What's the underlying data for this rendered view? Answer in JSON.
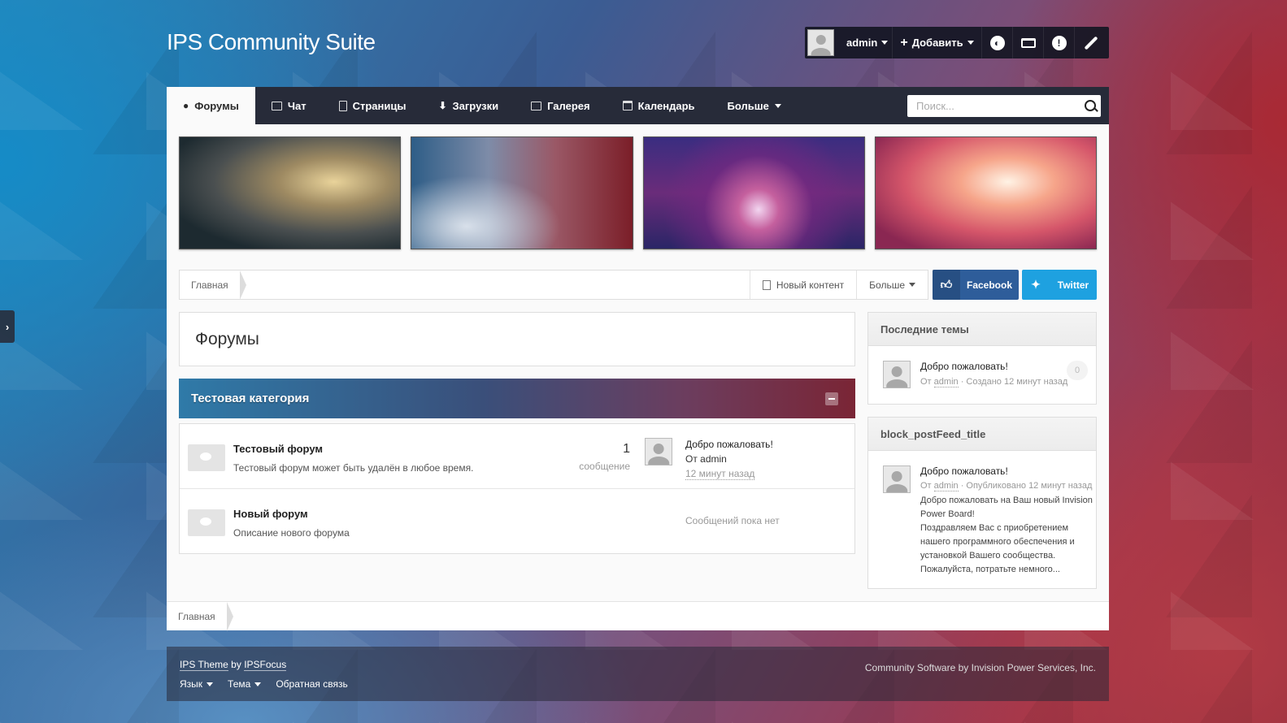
{
  "site": {
    "title": "IPS Community Suite"
  },
  "userbar": {
    "username": "admin",
    "create_label": "Добавить",
    "icons": [
      "globe-icon",
      "inbox-icon",
      "notifications-icon",
      "theme-brush-icon"
    ]
  },
  "nav": {
    "tabs": [
      {
        "label": "Форумы",
        "icon": "forums-icon",
        "active": true
      },
      {
        "label": "Чат",
        "icon": "chat-icon"
      },
      {
        "label": "Страницы",
        "icon": "pages-icon"
      },
      {
        "label": "Загрузки",
        "icon": "downloads-icon"
      },
      {
        "label": "Галерея",
        "icon": "gallery-icon"
      },
      {
        "label": "Календарь",
        "icon": "calendar-icon"
      },
      {
        "label": "Больше",
        "icon": "caret-down-icon"
      }
    ],
    "search_placeholder": "Поиск..."
  },
  "breadcrumb": {
    "home": "Главная",
    "new_content": "Новый контент",
    "more": "Больше"
  },
  "share": {
    "facebook": "Facebook",
    "twitter": "Twitter"
  },
  "page": {
    "title": "Форумы"
  },
  "category": {
    "title": "Тестовая категория",
    "forums": [
      {
        "title": "Тестовый форум",
        "description": "Тестовый форум может быть удалён в любое время.",
        "count": "1",
        "count_label": "сообщение",
        "last_title": "Добро пожаловать!",
        "last_by": "От admin",
        "last_time": "12 минут назад"
      },
      {
        "title": "Новый форум",
        "description": "Описание нового форума",
        "empty": "Сообщений пока нет"
      }
    ]
  },
  "sidebar": {
    "latest_topics": {
      "title": "Последние темы",
      "item": {
        "title": "Добро пожаловать!",
        "by_prefix": "От",
        "author": "admin",
        "meta_suffix": "· Создано 12 минут назад",
        "replies": "0"
      }
    },
    "post_feed": {
      "title": "block_postFeed_title",
      "item": {
        "title": "Добро пожаловать!",
        "by_prefix": "От",
        "author": "admin",
        "meta_suffix": "· Опубликовано 12 минут назад",
        "body_1": "Добро пожаловать на Ваш новый Invision Power Board!",
        "body_2": "Поздравляем Вас с приобретением нашего программного обеспечения и установкой Вашего сообщества. Пожалуйста, потратьте немного..."
      }
    }
  },
  "bottom_breadcrumb": {
    "home": "Главная"
  },
  "footer": {
    "theme_credit_prefix": "IPS Theme",
    "theme_credit_by": "by",
    "theme_credit_author": "IPSFocus",
    "language": "Язык",
    "theme": "Тема",
    "feedback": "Обратная связь",
    "copyright": "Community Software by Invision Power Services, Inc."
  }
}
